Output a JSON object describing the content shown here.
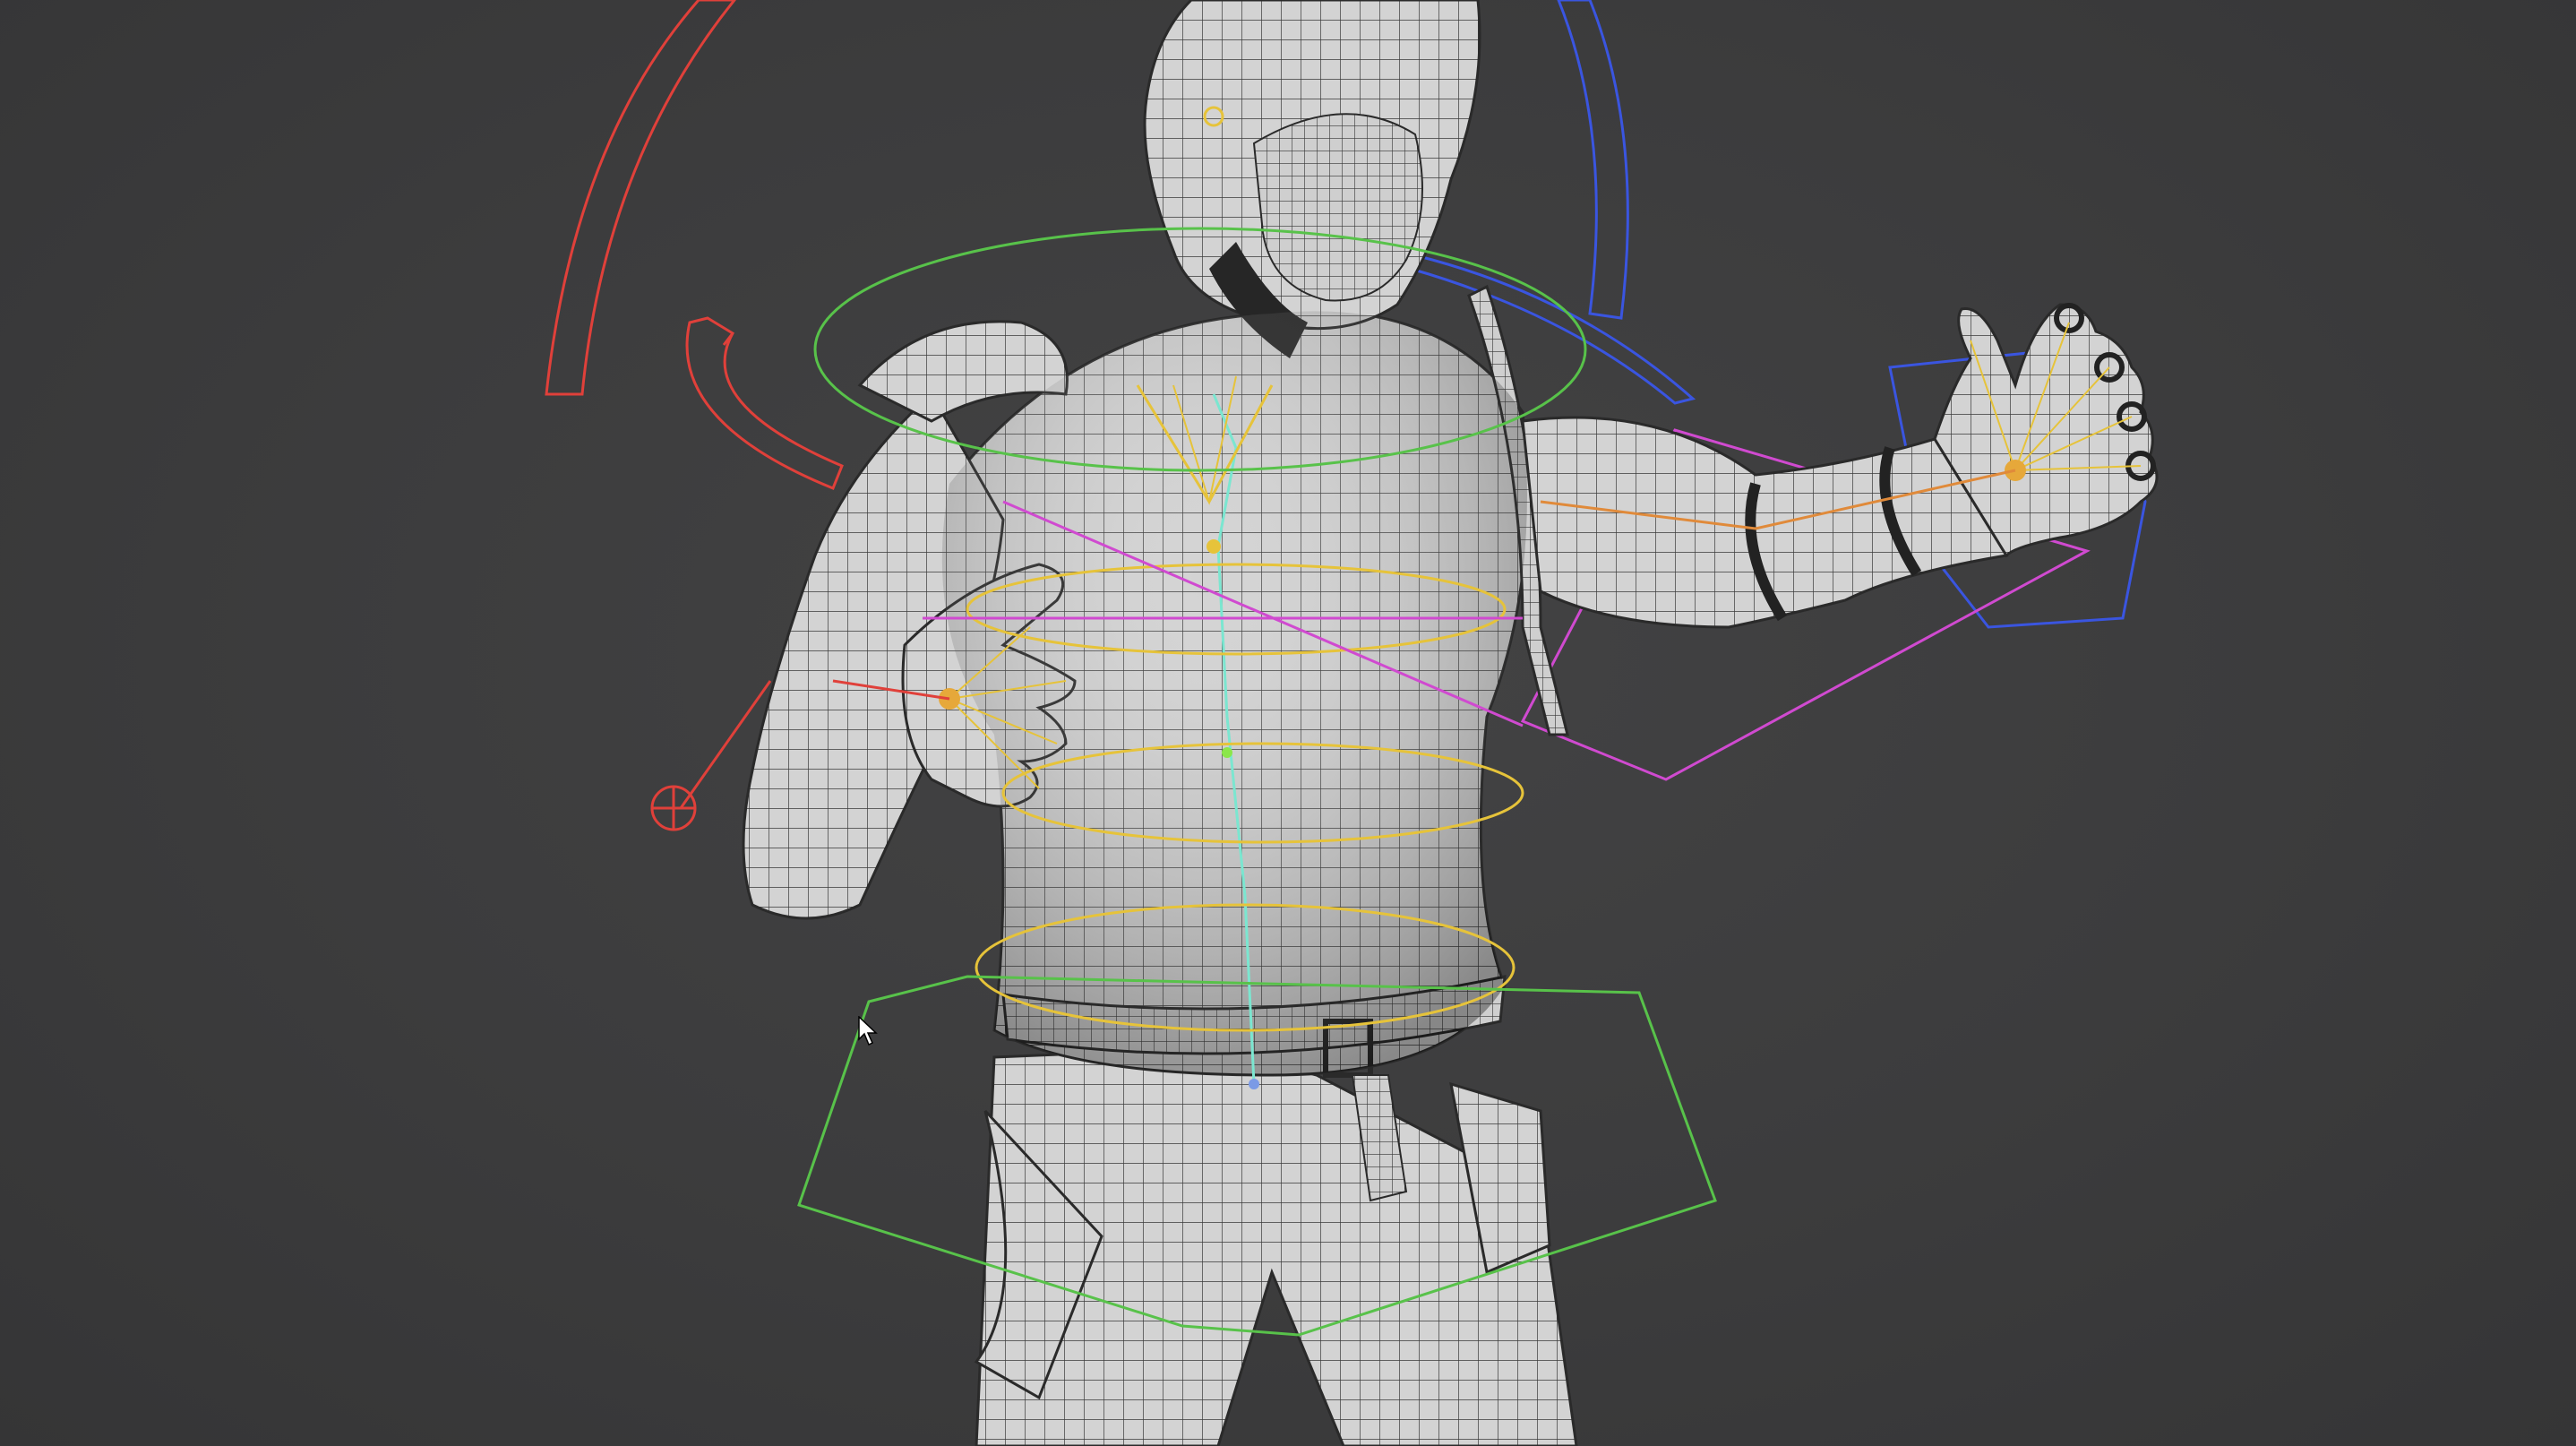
{
  "viewport": {
    "background_color": "#3b3b3c",
    "mesh_color": "#d4d4d4",
    "wire_color": "#2b2b2b"
  },
  "rig_controls": [
    {
      "name": "arm-ik-arc-left",
      "color": "#e0403a"
    },
    {
      "name": "arm-ik-arc-right",
      "color": "#3a55e0"
    },
    {
      "name": "chest-ring",
      "color": "#58c24a"
    },
    {
      "name": "spine-ring-upper",
      "color": "#e6c33a"
    },
    {
      "name": "spine-ring-lower",
      "color": "#e6c33a"
    },
    {
      "name": "hip-ring",
      "color": "#e6c33a"
    },
    {
      "name": "root-control",
      "color": "#58c24a"
    },
    {
      "name": "arm-fk-control",
      "color": "#d04ad0"
    },
    {
      "name": "hand-control",
      "color": "#3a55e0"
    },
    {
      "name": "pole-vector-target",
      "color": "#e0403a"
    }
  ],
  "cursor": {
    "icon": "arrow-cursor-icon"
  }
}
